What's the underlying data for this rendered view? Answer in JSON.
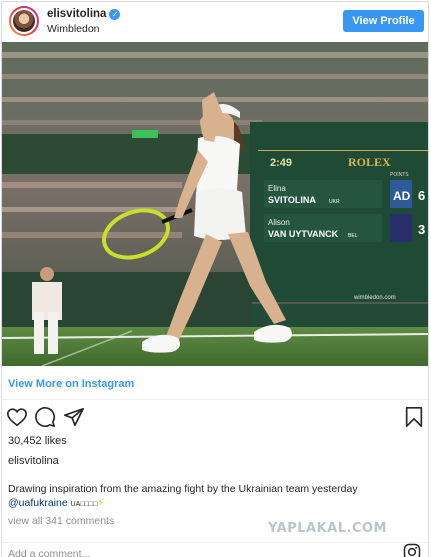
{
  "post": {
    "username": "elisvitolina",
    "verified_mark": "✓",
    "location": "Wimbledon",
    "view_profile_label": "View Profile",
    "view_more_label": "View More on Instagram",
    "likes": "30,452 likes",
    "caption_username": "elisvitolina",
    "caption_text": "Drawing inspiration from the amazing fight by the Ukrainian team yesterday",
    "caption_mention": "@uafukraine",
    "caption_flags": "UA□□□□",
    "caption_emoji": "⚡",
    "comments_link": "view all 341 comments",
    "add_comment_placeholder": "Add a comment..."
  },
  "scoreboard": {
    "time": "2:49",
    "brand": "ROLEX",
    "points_label": "POINTS",
    "player1_first": "Elina",
    "player1_last": "SVITOLINA",
    "player1_country": "UKR",
    "player1_points": "AD",
    "player1_games": "6",
    "player2_first": "Alison",
    "player2_last": "VAN UYTVANCK",
    "player2_country": "BEL",
    "player2_games": "3",
    "site": "wimbledon.com"
  },
  "watermark": "YAPLAKAL.COM",
  "icons": {
    "like": "heart-icon",
    "comment": "comment-icon",
    "share": "share-icon",
    "save": "bookmark-icon",
    "instagram": "instagram-icon"
  },
  "colors": {
    "accent": "#3897f0",
    "court_green": "#4d7a3a",
    "scoreboard": "#1f4a35"
  }
}
